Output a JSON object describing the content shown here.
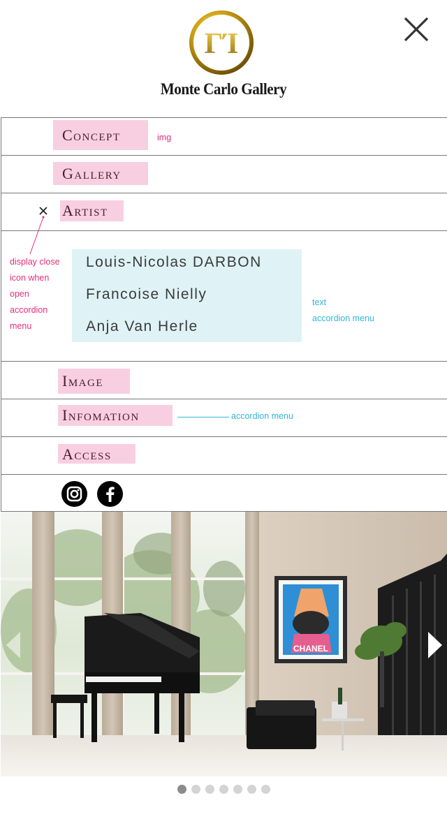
{
  "brand": {
    "name": "Monte Carlo Gallery",
    "logo_letters": "ΓΊ",
    "logo_color": "#c9a21a"
  },
  "header": {
    "close_icon": "close-icon"
  },
  "menu": {
    "items": [
      {
        "label": "Concept"
      },
      {
        "label": "Gallery"
      },
      {
        "label": "Artist"
      },
      {
        "label": "Image"
      },
      {
        "label": "Infomation"
      },
      {
        "label": "Access"
      }
    ],
    "accent_color": "#f8cfe0"
  },
  "artist_accordion": {
    "artists": [
      "Louis-Nicolas DARBON",
      "Francoise Nielly",
      "Anja Van Herle"
    ]
  },
  "annotations": {
    "img": "img",
    "close_icon_note": [
      "display close",
      "icon when",
      "open",
      "accordion",
      "menu"
    ],
    "text_note": [
      "text",
      "accordion menu"
    ],
    "info_note": "accordion menu",
    "pink_color": "#e2307a",
    "cyan_color": "#35b5d4"
  },
  "social": {
    "icons": [
      "instagram-icon",
      "facebook-icon"
    ]
  },
  "hero": {
    "poster_text": "CHANEL",
    "arrows": [
      "chevron-left-icon",
      "chevron-right-icon"
    ]
  },
  "carousel": {
    "total_slides": 7,
    "active_index": 0
  }
}
